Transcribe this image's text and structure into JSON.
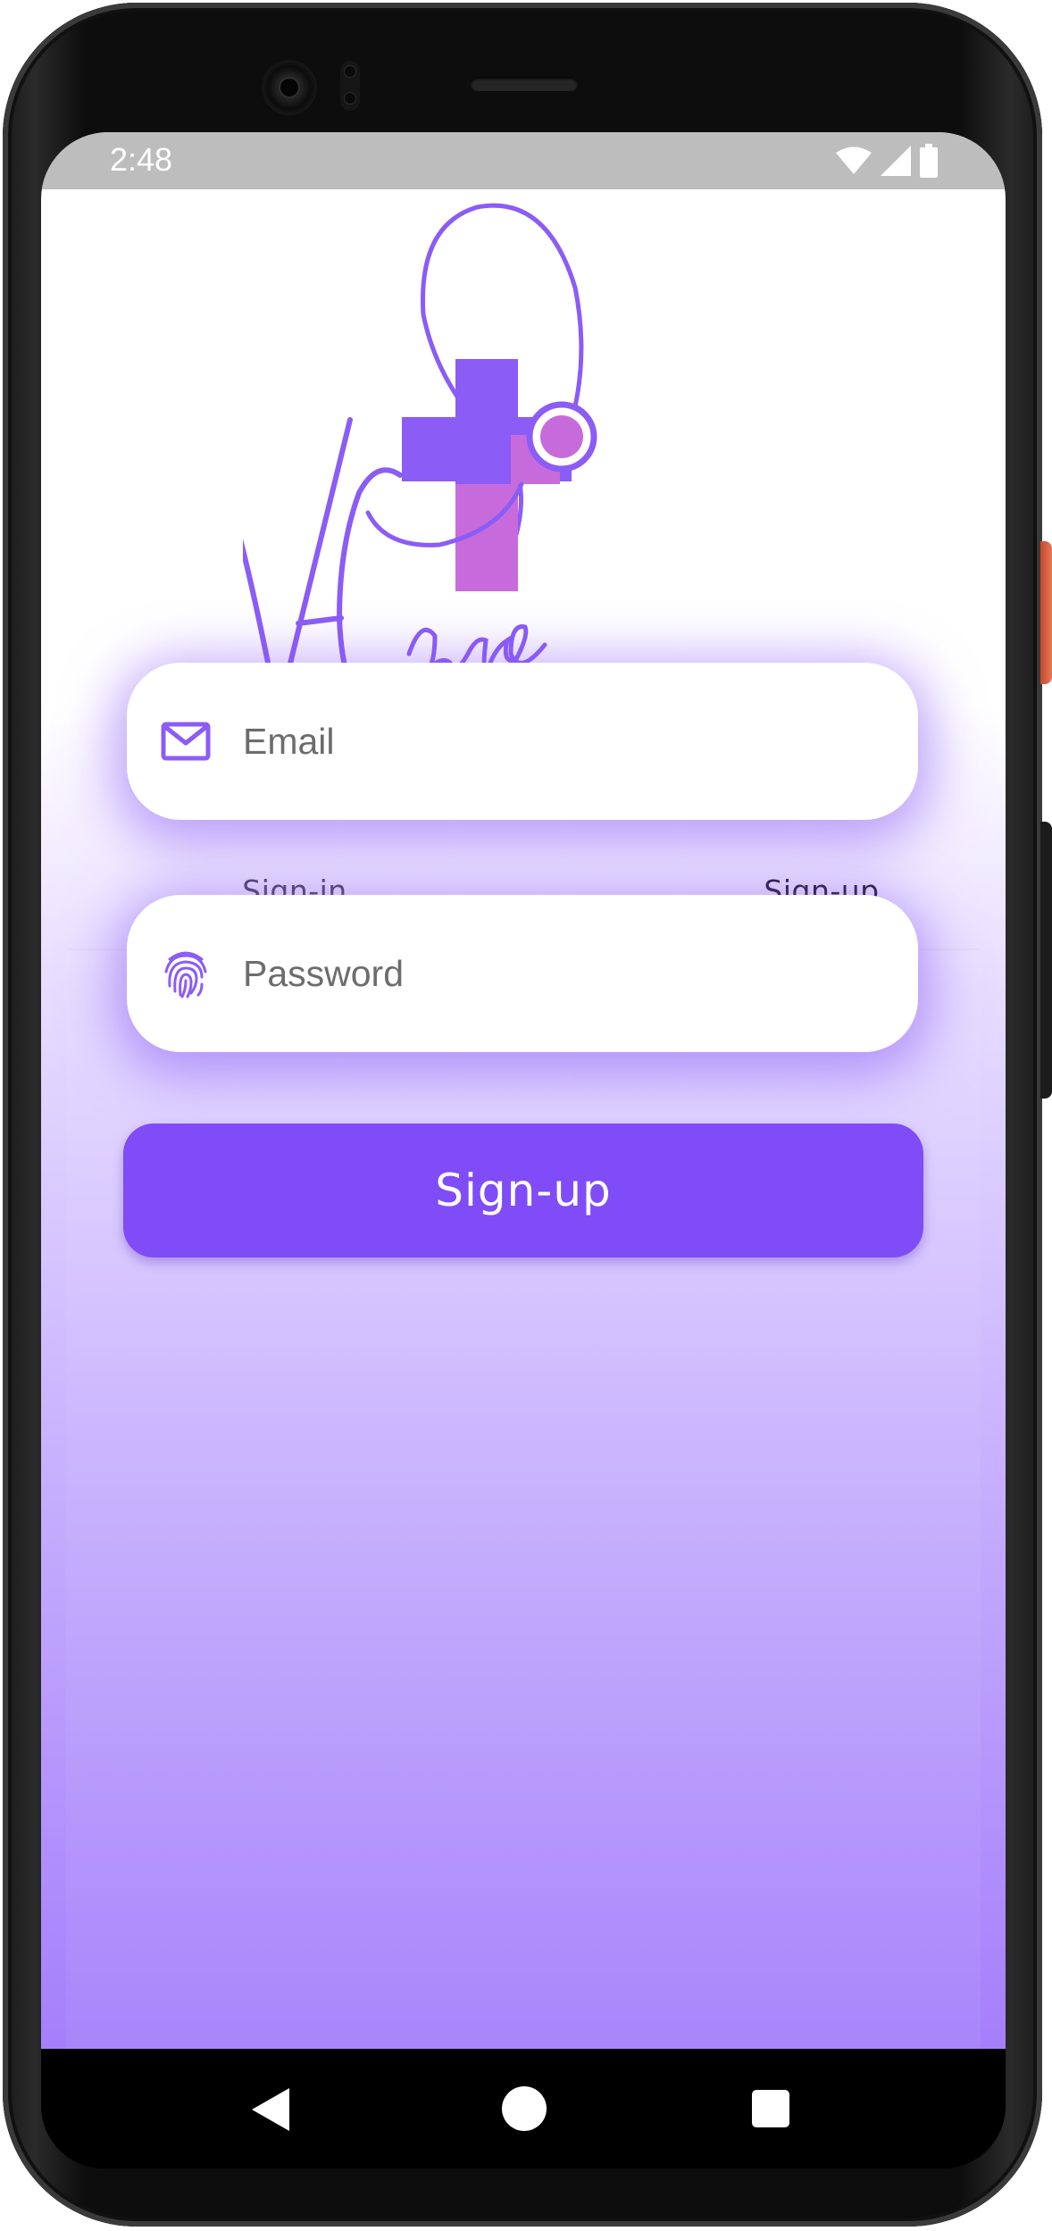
{
  "status_bar": {
    "time": "2:48",
    "wifi_icon": "wifi-icon",
    "signal_icon": "signal-icon",
    "battery_icon": "battery-icon"
  },
  "logo": {
    "text": "V-Care",
    "icon": "medical-cross-stethoscope-logo",
    "colors": {
      "primary": "#8b5cf6",
      "accent": "#c76bdc"
    }
  },
  "tabs": [
    {
      "label": "Sign-in",
      "selected": false
    },
    {
      "label": "Sign-up",
      "selected": true
    }
  ],
  "form": {
    "email": {
      "placeholder": "Email",
      "value": "",
      "icon": "mail-icon"
    },
    "password": {
      "placeholder": "Password",
      "value": "",
      "icon": "fingerprint-icon"
    },
    "submit_label": "Sign-up"
  },
  "nav_bar": {
    "back_icon": "back-triangle-icon",
    "home_icon": "home-circle-icon",
    "recents_icon": "recents-square-icon"
  },
  "theme": {
    "accent": "#7f4cf8",
    "tab_indicator": "#6a52b8"
  }
}
